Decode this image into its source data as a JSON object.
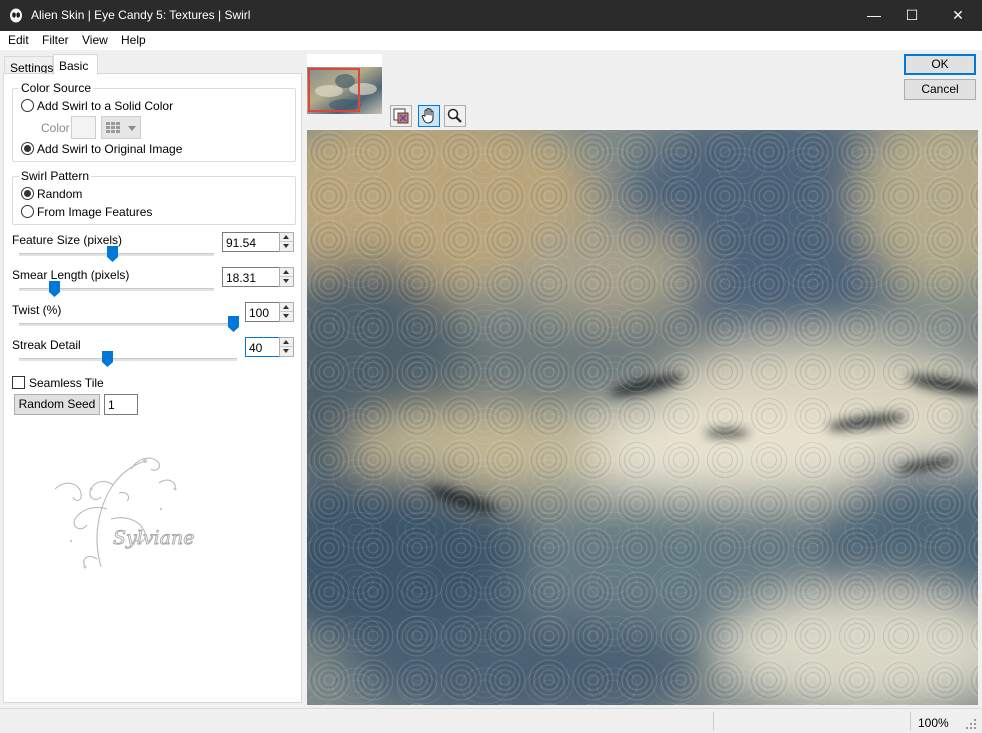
{
  "window": {
    "title": "Alien Skin | Eye Candy 5: Textures | Swirl",
    "minimize_glyph": "—",
    "maximize_glyph": "☐",
    "close_glyph": "✕"
  },
  "menu": [
    "Edit",
    "Filter",
    "View",
    "Help"
  ],
  "tabs": {
    "settings": "Settings",
    "basic": "Basic"
  },
  "color_source": {
    "title": "Color Source",
    "option_solid": "Add Swirl to a Solid Color",
    "color_label": "Color",
    "option_original": "Add Swirl to Original Image",
    "selected": "original"
  },
  "swirl_pattern": {
    "title": "Swirl Pattern",
    "option_random": "Random",
    "option_features": "From Image Features",
    "selected": "random"
  },
  "sliders": {
    "feature_size": {
      "label": "Feature Size (pixels)",
      "value": "91.54",
      "fraction": 0.46
    },
    "smear_length": {
      "label": "Smear Length (pixels)",
      "value": "18.31",
      "fraction": 0.18
    },
    "twist": {
      "label": "Twist (%)",
      "value": "100",
      "fraction": 1.0
    },
    "streak_detail": {
      "label": "Streak Detail",
      "value": "40",
      "fraction": 0.4
    }
  },
  "seamless_tile": {
    "label": "Seamless Tile",
    "checked": false
  },
  "random_seed": {
    "button_label": "Random Seed",
    "value": "1"
  },
  "watermark_text": "Sylviane",
  "buttons": {
    "ok": "OK",
    "cancel": "Cancel"
  },
  "status": {
    "zoom": "100%"
  },
  "colors": {
    "accent": "#0078d7",
    "titlebar": "#2b2b2b",
    "thumb_frame": "#e0453a"
  },
  "icons": [
    "app-logo-icon",
    "compare-icon",
    "hand-tool-icon",
    "zoom-tool-icon",
    "size-grip-icon"
  ]
}
